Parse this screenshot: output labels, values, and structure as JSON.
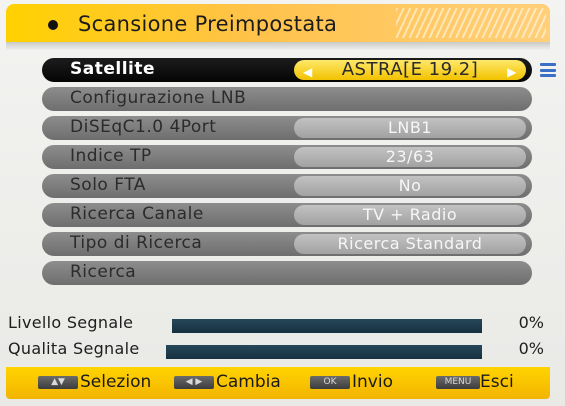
{
  "header": {
    "title": "Scansione Preimpostata"
  },
  "menu": {
    "rows": [
      {
        "label": "Satellite",
        "value": "ASTRA[E 19.2]"
      },
      {
        "label": "Configurazione LNB",
        "value": ""
      },
      {
        "label": "DiSEqC1.0 4Port",
        "value": "LNB1"
      },
      {
        "label": "Indice TP",
        "value": "23/63"
      },
      {
        "label": "Solo FTA",
        "value": "No"
      },
      {
        "label": "Ricerca Canale",
        "value": "TV + Radio"
      },
      {
        "label": "Tipo di Ricerca",
        "value": "Ricerca Standard"
      },
      {
        "label": "Ricerca",
        "value": ""
      }
    ]
  },
  "signal": {
    "level": {
      "label": "Livello Segnale",
      "percent": "0%"
    },
    "quality": {
      "label": "Qualita Segnale",
      "percent": "0%"
    }
  },
  "footer": {
    "keys": [
      {
        "key": "▲▼",
        "label": "Selezion"
      },
      {
        "key": "◀ ▶",
        "label": "Cambia"
      },
      {
        "key": "OK",
        "label": "Invio"
      },
      {
        "key": "MENU",
        "label": "Esci"
      }
    ]
  },
  "colors": {
    "header": "#ffd100",
    "selected_value": "#f2c200",
    "bar": "#163040"
  }
}
